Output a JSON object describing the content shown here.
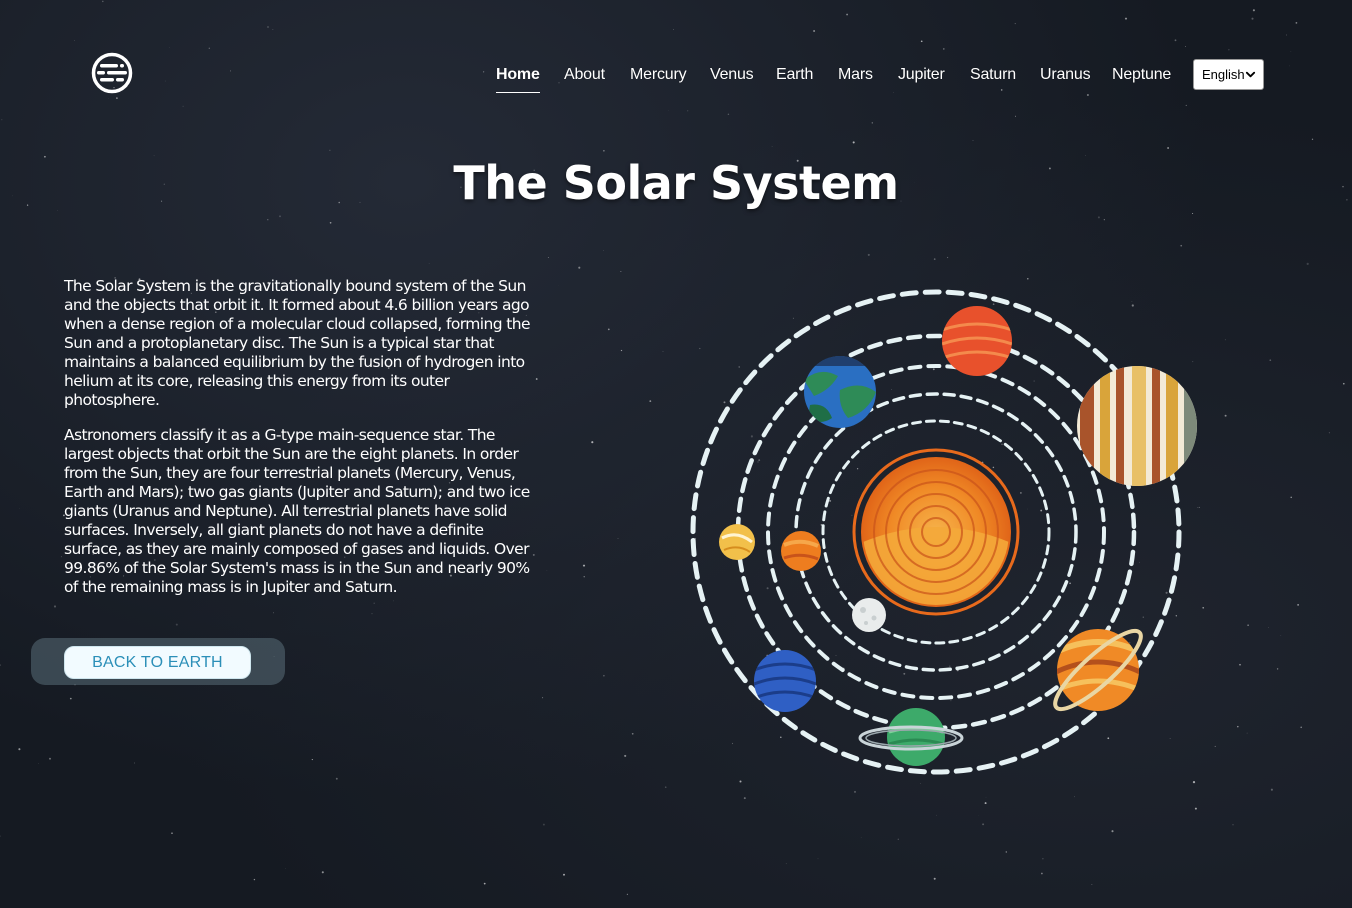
{
  "nav": {
    "items": [
      {
        "label": "Home",
        "active": true
      },
      {
        "label": "About",
        "active": false
      },
      {
        "label": "Mercury",
        "active": false
      },
      {
        "label": "Venus",
        "active": false
      },
      {
        "label": "Earth",
        "active": false
      },
      {
        "label": "Mars",
        "active": false
      },
      {
        "label": "Jupiter",
        "active": false
      },
      {
        "label": "Saturn",
        "active": false
      },
      {
        "label": "Uranus",
        "active": false
      },
      {
        "label": "Neptune",
        "active": false
      }
    ],
    "language": {
      "selected": "English"
    }
  },
  "page": {
    "title": "The Solar System",
    "paragraphs": [
      "The Solar System is the gravitationally bound system of the Sun and the objects that orbit it. It formed about 4.6 billion years ago when a dense region of a molecular cloud collapsed, forming the Sun and a protoplanetary disc. The Sun is a typical star that maintains a balanced equilibrium by the fusion of hydrogen into helium at its core, releasing this energy from its outer photosphere.",
      "Astronomers classify it as a G-type main-sequence star. The largest objects that orbit the Sun are the eight planets. In order from the Sun, they are four terrestrial planets (Mercury, Venus, Earth and Mars); two gas giants (Jupiter and Saturn); and two ice giants (Uranus and Neptune). All terrestrial planets have solid surfaces. Inversely, all giant planets do not have a definite surface, as they are mainly composed of gases and liquids. Over 99.86% of the Solar System's mass is in the Sun and nearly 90% of the remaining mass is in Jupiter and Saturn."
    ],
    "back_button_label": "BACK TO EARTH"
  },
  "colors": {
    "background": "#151a22",
    "button_text": "#2b8fb8",
    "button_bg": "#f2fbff",
    "orbit": "#e6f2f4",
    "sun_outer": "#e86a1c",
    "sun_inner": "#f4a83a"
  },
  "icons": {
    "logo": "striped-globe-logo-icon",
    "language_dropdown": "chevron-down-icon"
  }
}
